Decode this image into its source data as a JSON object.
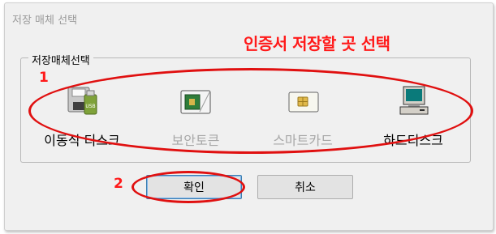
{
  "dialog": {
    "title": "저장 매체 선택",
    "group_label": "저장매체선택"
  },
  "annotations": {
    "title": "인증서 저장할 곳 선택",
    "step1": "1",
    "step2": "2",
    "color": "#ff1a1a"
  },
  "media": [
    {
      "label": "이동식 디스크",
      "icon": "removable-disk-icon",
      "enabled": true
    },
    {
      "label": "보안토큰",
      "icon": "security-token-icon",
      "enabled": false
    },
    {
      "label": "스마트카드",
      "icon": "smart-card-icon",
      "enabled": false
    },
    {
      "label": "하드디스크",
      "icon": "hard-disk-computer-icon",
      "enabled": true
    }
  ],
  "buttons": {
    "ok": "확인",
    "cancel": "취소"
  }
}
